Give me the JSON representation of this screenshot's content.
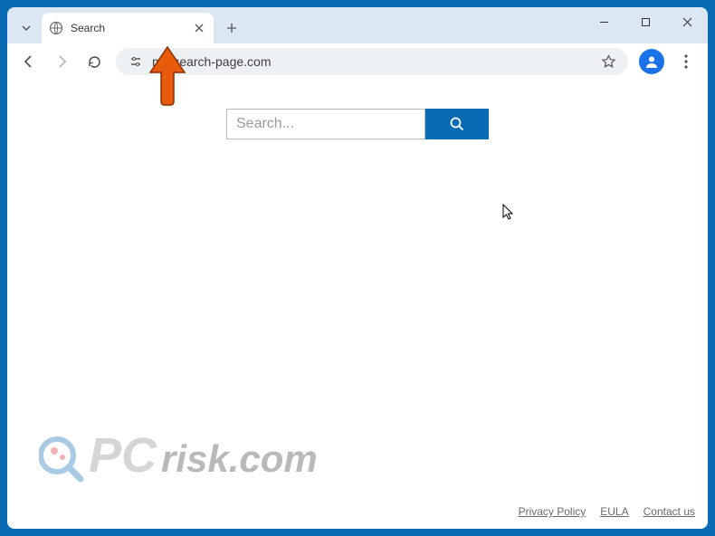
{
  "tab": {
    "title": "Search"
  },
  "omnibox": {
    "url": "my-search-page.com"
  },
  "search": {
    "placeholder": "Search..."
  },
  "footer": {
    "privacy": "Privacy Policy",
    "eula": "EULA",
    "contact": "Contact us"
  },
  "watermark": {
    "text": "PCrisk.com"
  }
}
